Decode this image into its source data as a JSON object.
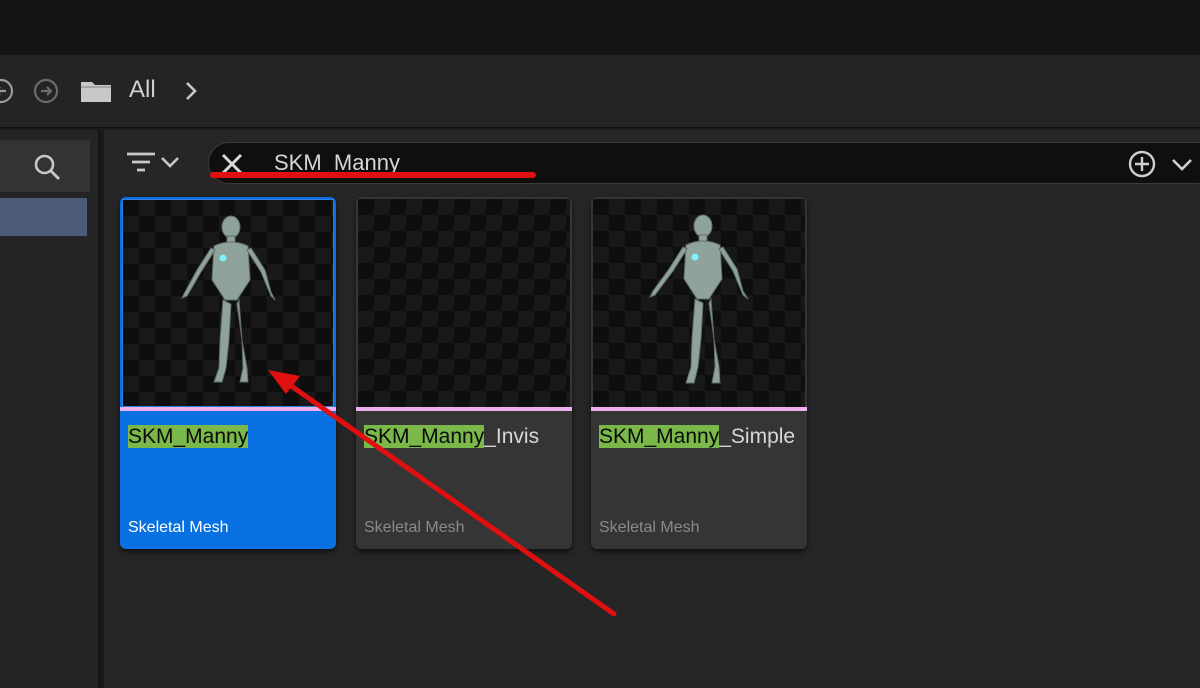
{
  "breadcrumb": {
    "current": "All"
  },
  "search": {
    "value": "SKM_Manny"
  },
  "assets": [
    {
      "name_highlight": "SKM_Manny",
      "name_rest": "",
      "type": "Skeletal Mesh",
      "selected": true,
      "thumbnail": "manny-figure"
    },
    {
      "name_highlight": "SKM_Manny",
      "name_rest": "_Invis",
      "type": "Skeletal Mesh",
      "selected": false,
      "thumbnail": "empty"
    },
    {
      "name_highlight": "SKM_Manny",
      "name_rest": "_Simple",
      "type": "Skeletal Mesh",
      "selected": false,
      "thumbnail": "manny-figure"
    }
  ],
  "colors": {
    "selection": "#0870e0",
    "match_highlight": "#7ab84a",
    "asset_type_bar": "#f0b0f0",
    "annotation": "#e01010"
  }
}
